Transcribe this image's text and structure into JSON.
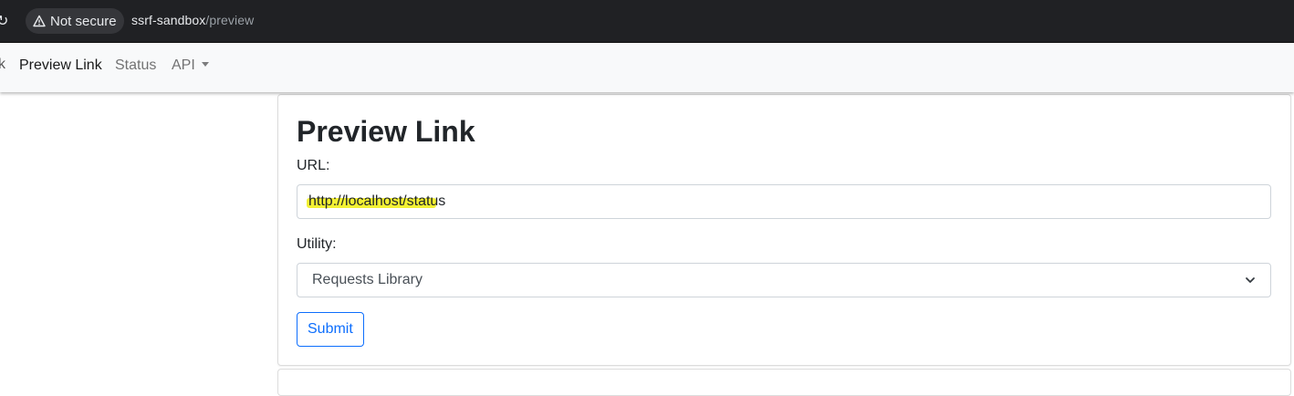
{
  "browser": {
    "security_label": "Not secure",
    "url_host": "ssrf-sandbox",
    "url_path": "/preview"
  },
  "navbar": {
    "fragment": "k",
    "items": [
      {
        "label": "Preview Link",
        "active": true
      },
      {
        "label": "Status",
        "active": false
      },
      {
        "label": "API",
        "active": false
      }
    ]
  },
  "form": {
    "title": "Preview Link",
    "url_label": "URL:",
    "url_value": "http://localhost/status",
    "utility_label": "Utility:",
    "utility_selected": "Requests Library",
    "submit_label": "Submit"
  },
  "colors": {
    "accent": "#0d6efd",
    "highlight": "#f2ef1e"
  }
}
